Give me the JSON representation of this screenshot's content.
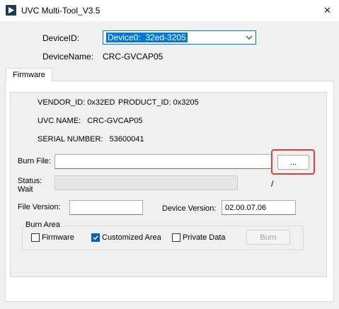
{
  "window": {
    "title": "UVC Multi-Tool_V3.5",
    "close_glyph": "✕",
    "app_icon": "play-triangle-icon"
  },
  "device": {
    "id_label": "DeviceID:",
    "id_value": "Device0:  32ed-3205",
    "name_label": "DeviceName:",
    "name_value": "CRC-GVCAP05"
  },
  "tabs": [
    {
      "label": "Firmware",
      "selected": true
    }
  ],
  "info": {
    "vendor_id": "VENDOR_ID:  0x32ED",
    "product_id": "PRODUCT_ID:  0x3205",
    "uvc_name": "UVC NAME:   CRC-GVCAP05",
    "serial_number": "SERIAL NUMBER:   53600041"
  },
  "burn_file": {
    "label": "Burn File:",
    "value": "",
    "browse_label": "...",
    "highlight_color": "#e0403a"
  },
  "status": {
    "label_line1": "Status:",
    "label_line2": "Wait",
    "progress": 0,
    "slash": "/"
  },
  "versions": {
    "file_label": "File Version:",
    "file_value": "",
    "device_label": "Device Version:",
    "device_value": "02.00.07.06"
  },
  "burn_area": {
    "legend": "Burn Area",
    "options": [
      {
        "label": "Firmware",
        "checked": false
      },
      {
        "label": "Customized Area",
        "checked": true
      },
      {
        "label": "Private Data",
        "checked": false
      }
    ],
    "burn_button": "Burn",
    "burn_enabled": false
  },
  "colors": {
    "accent": "#0078d7",
    "checkbox_checked": "#0060c0"
  }
}
